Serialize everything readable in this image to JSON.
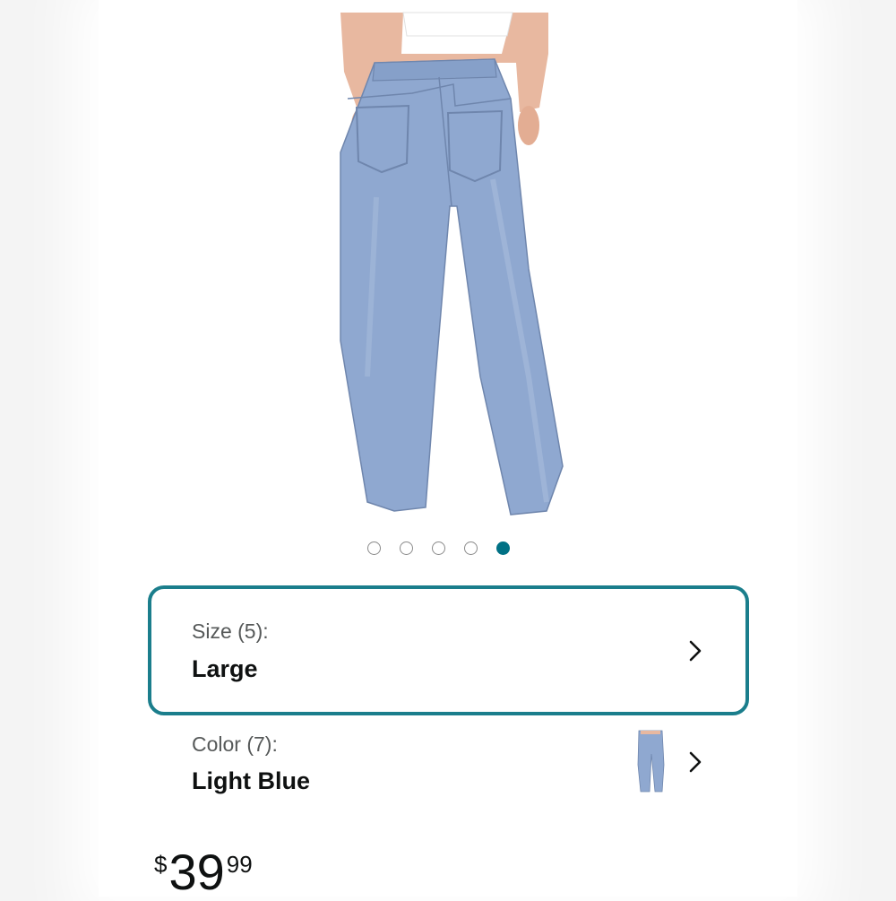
{
  "carousel": {
    "total": 5,
    "active_index": 4,
    "active_color": "#007185"
  },
  "size_option": {
    "label": "Size (5):",
    "value": "Large",
    "highlight_color": "#1b7e8c"
  },
  "color_option": {
    "label": "Color (7):",
    "value": "Light Blue"
  },
  "price": {
    "symbol": "$",
    "whole": "39",
    "fraction": "99"
  },
  "icons": [
    "chevron-right-icon",
    "chevron-right-icon"
  ],
  "colors": {
    "denim": "#8fa8d0",
    "background": "#ffffff"
  }
}
